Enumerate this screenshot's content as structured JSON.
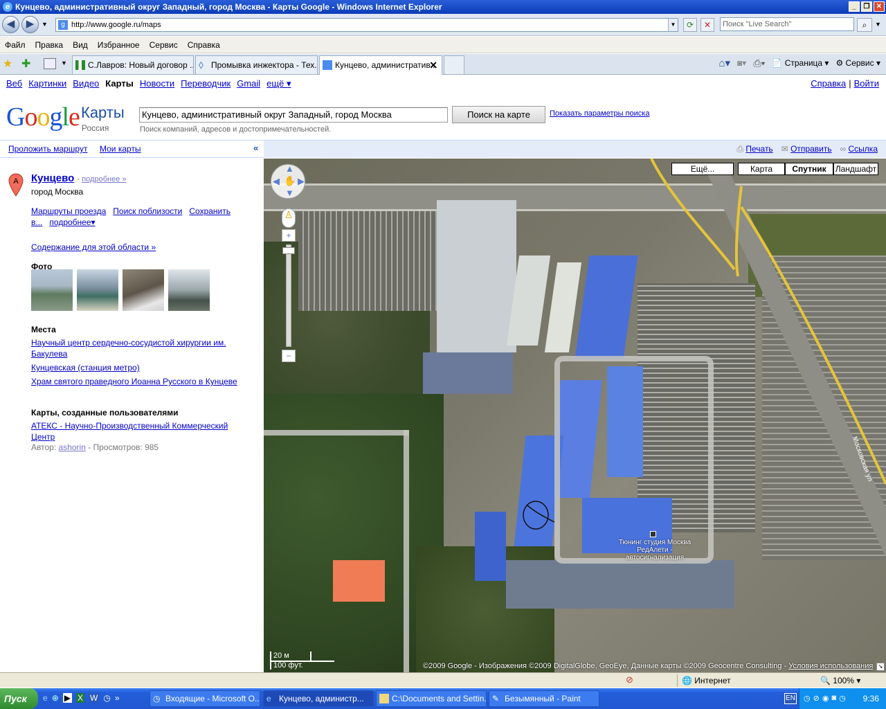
{
  "window": {
    "title": "Кунцево, административный округ Западный, город Москва - Карты Google - Windows Internet Explorer"
  },
  "address": {
    "url": "http://www.google.ru/maps",
    "search_placeholder": "Поиск \"Live Search\""
  },
  "menu": [
    "Файл",
    "Правка",
    "Вид",
    "Избранное",
    "Сервис",
    "Справка"
  ],
  "tabs": [
    {
      "label": "С.Лавров: Новый договор ..."
    },
    {
      "label": "Промывка инжектора - Тех..."
    },
    {
      "label": "Кунцево, административ..."
    }
  ],
  "commandbar": {
    "page": "Страница",
    "tools": "Сервис"
  },
  "gbar": {
    "links": [
      "Веб",
      "Картинки",
      "Видео",
      "Карты",
      "Новости",
      "Переводчик",
      "Gmail",
      "ещё ▾"
    ],
    "help": "Справка",
    "signin": "Войти"
  },
  "header": {
    "product": "Карты",
    "country": "Россия",
    "query": "Кунцево, административный округ Западный, город Москва",
    "search_button": "Поиск на карте",
    "options": "Показать параметры поиска",
    "hint": "Поиск компаний, адресов и достопримечательностей."
  },
  "leftbar": {
    "route": "Проложить маршрут",
    "mymaps": "Мои карты",
    "collapse": "«"
  },
  "mapbar": {
    "print": "Печать",
    "send": "Отправить",
    "link": "Ссылка"
  },
  "place": {
    "title": "Кунцево",
    "more": "подробнее »",
    "subtitle": "город Москва",
    "routes": "Маршруты проезда",
    "nearby": "Поиск поблизости",
    "save1": "Сохранить",
    "save2": "в...",
    "details": "подробнее▾",
    "contents": "Содержание для этой области »"
  },
  "photos": {
    "heading": "Фото"
  },
  "places": {
    "heading": "Места",
    "items": [
      "Научный центр сердечно-сосудистой хирургии им. Бакулева",
      "Кунцевская (станция метро)",
      "Храм святого праведного Иоанна Русского в Кунцеве"
    ]
  },
  "usermaps": {
    "heading": "Карты, созданные пользователями",
    "link": "АТЕКС - Научно-Производственный Коммерческий Центр",
    "author_label": "Автор:",
    "author": "ashorin",
    "views": "- Просмотров: 985"
  },
  "map": {
    "types": [
      "Ещё...",
      "Карта",
      "Спутник",
      "Ландшафт"
    ],
    "selected_type": "Спутник",
    "poi": "Тюнинг студия Москва РедАлети - автосигнализация",
    "scale_m": "20 м",
    "scale_ft": "100 фут.",
    "credits": "©2009 Google - Изображения ©2009 DigitalGlobe, GeoEye, Данные карты ©2009 Geocentre Consulting - ",
    "terms": "Условия использования",
    "road_label": "Московская ул"
  },
  "statusbar": {
    "zone": "Интернет",
    "zoom": "100%"
  },
  "taskbar": {
    "start": "Пуск",
    "items": [
      "Входящие - Microsoft O...",
      "Кунцево, администр...",
      "C:\\Documents and Settin...",
      "Безымянный - Paint"
    ],
    "lang": "EN",
    "clock": "9:36"
  }
}
